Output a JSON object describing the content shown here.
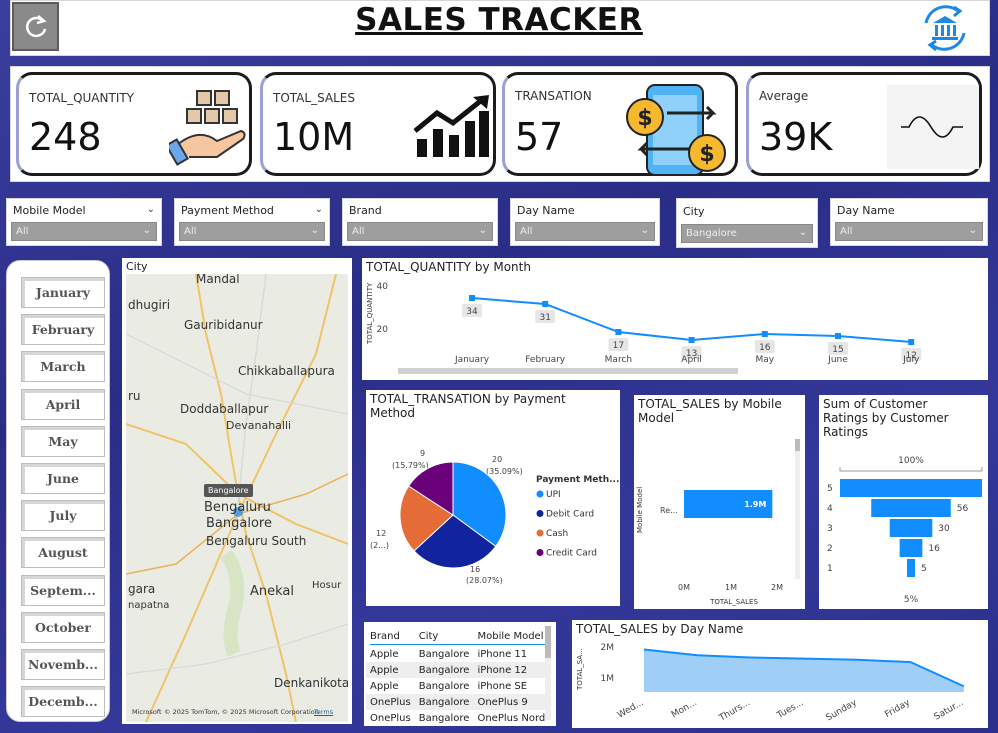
{
  "header": {
    "title": "SALES TRACKER",
    "refresh_icon": "refresh-icon",
    "bank_icon": "bank-icon"
  },
  "kpis": [
    {
      "label": "TOTAL_QUANTITY",
      "value": "248",
      "icon": "boxes-hand-icon"
    },
    {
      "label": "TOTAL_SALES",
      "value": "10M",
      "icon": "growth-chart-icon"
    },
    {
      "label": "TRANSATION",
      "value": "57",
      "icon": "phone-money-transfer-icon"
    },
    {
      "label": "Average",
      "value": "39K",
      "icon": "wave-icon"
    }
  ],
  "slicers": [
    {
      "label": "Mobile Model",
      "value": "All"
    },
    {
      "label": "Payment Method",
      "value": "All"
    },
    {
      "label": "Brand",
      "value": "All"
    },
    {
      "label": "Day Name",
      "value": "All"
    },
    {
      "label": "City",
      "value": "Bangalore"
    },
    {
      "label": "Day Name",
      "value": "All"
    }
  ],
  "months": [
    "January",
    "February",
    "March",
    "April",
    "May",
    "June",
    "July",
    "August",
    "Septem...",
    "October",
    "Novemb...",
    "Decemb..."
  ],
  "map": {
    "title": "City",
    "bubble": "Bangalore",
    "attribution": "© 2025 TomTom, © 2025 Microsoft Corporation",
    "terms": "Terms",
    "brand": "Microsoft",
    "places": [
      "Mandal",
      "dhugiri",
      "Gauribidanur",
      "Chikkaballapura",
      "ru",
      "Doddaballapur",
      "Devanahalli",
      "Bengaluru",
      "Bangalore",
      "Bengaluru South",
      "gara",
      "napatna",
      "Anekal",
      "Hosur",
      "Denkanikota"
    ]
  },
  "qty_month": {
    "title": "TOTAL_QUANTITY by Month",
    "ylabel": "TOTAL_QUANTITY",
    "yticks": [
      "40",
      "20"
    ]
  },
  "pie": {
    "title": "TOTAL_TRANSATION by Payment Method",
    "legend_title": "Payment Meth...",
    "labels": [
      {
        "top": "20",
        "bottom": "(35.09%)"
      },
      {
        "top": "16",
        "bottom": "(28.07%)"
      },
      {
        "top": "12",
        "bottom": "(2...)"
      },
      {
        "top": "9",
        "bottom": "(15.79%)"
      }
    ]
  },
  "sales_model": {
    "title": "TOTAL_SALES by Mobile Model",
    "ylabel": "Mobile Model",
    "xlabel": "TOTAL_SALES",
    "category": "Re...",
    "bar_label": "1.9M",
    "xticks": [
      "0M",
      "1M",
      "2M"
    ]
  },
  "funnel": {
    "title": "Sum of Customer Ratings by Customer Ratings",
    "top_pct": "100%",
    "bottom_pct": "5%"
  },
  "table": {
    "headers": [
      "Brand",
      "City",
      "Mobile Model"
    ],
    "rows": [
      [
        "Apple",
        "Bangalore",
        "iPhone 11"
      ],
      [
        "Apple",
        "Bangalore",
        "iPhone 12"
      ],
      [
        "Apple",
        "Bangalore",
        "iPhone SE"
      ],
      [
        "OnePlus",
        "Bangalore",
        "OnePlus 9"
      ],
      [
        "OnePlus",
        "Bangalore",
        "OnePlus Nord"
      ]
    ]
  },
  "sales_day": {
    "title": "TOTAL_SALES by Day Name",
    "ylabel": "TOTAL_SA...",
    "yticks": [
      "2M",
      "1M"
    ]
  },
  "chart_data": [
    {
      "type": "line",
      "title": "TOTAL_QUANTITY by Month",
      "ylabel": "TOTAL_QUANTITY",
      "categories": [
        "January",
        "February",
        "March",
        "April",
        "May",
        "June",
        "July"
      ],
      "values": [
        34,
        31,
        17,
        13,
        16,
        15,
        12
      ],
      "color": "#118DFF"
    },
    {
      "type": "pie",
      "title": "TOTAL_TRANSATION by Payment Method",
      "legend_title": "Payment Meth...",
      "categories": [
        "UPI",
        "Debit Card",
        "Cash",
        "Credit Card"
      ],
      "values": [
        20,
        16,
        12,
        9
      ],
      "colors": [
        "#118DFF",
        "#12239E",
        "#E66C37",
        "#6B007B"
      ]
    },
    {
      "type": "bar",
      "title": "TOTAL_SALES by Mobile Model",
      "categories": [
        "Re..."
      ],
      "values": [
        1900000
      ],
      "xlim": [
        0,
        2000000
      ],
      "color": "#118DFF"
    },
    {
      "type": "bar",
      "title": "Sum of Customer Ratings by Customer Ratings",
      "categories": [
        "5",
        "4",
        "3",
        "2",
        "1"
      ],
      "values": [
        100,
        56,
        30,
        16,
        5
      ],
      "color": "#118DFF"
    },
    {
      "type": "area",
      "title": "TOTAL_SALES by Day Name",
      "ylabel": "TOTAL_SA...",
      "categories": [
        "Wed...",
        "Mon...",
        "Thurs...",
        "Tues...",
        "Sunday",
        "Friday",
        "Satur..."
      ],
      "values": [
        1850000,
        1600000,
        1500000,
        1450000,
        1400000,
        1300000,
        250000
      ],
      "ylim": [
        0,
        2000000
      ],
      "color": "#118DFF"
    }
  ]
}
